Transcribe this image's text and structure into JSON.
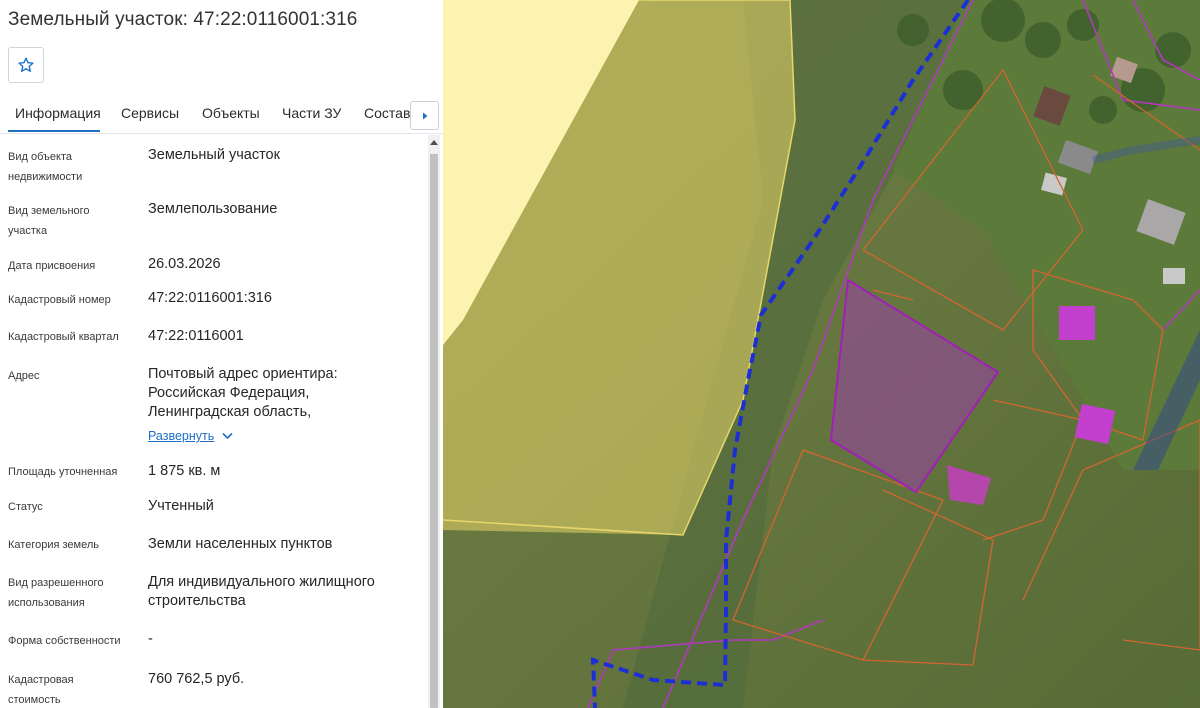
{
  "header": {
    "title": "Земельный участок: 47:22:0116001:316",
    "favorite_icon": "star-outline-icon"
  },
  "tabs": [
    {
      "label": "Информация",
      "active": true
    },
    {
      "label": "Сервисы"
    },
    {
      "label": "Объекты"
    },
    {
      "label": "Части ЗУ"
    },
    {
      "label": "Состав"
    }
  ],
  "tabs_next_icon": "caret-right-icon",
  "info": {
    "object_type": {
      "label_1": "Вид объекта",
      "label_2": "недвижимости",
      "value": "Земельный участок"
    },
    "parcel_type": {
      "label_1": "Вид земельного",
      "label_2": "участка",
      "value": "Землепользование"
    },
    "date": {
      "label": "Дата присвоения",
      "value": "26.03.2026"
    },
    "cad_number": {
      "label": "Кадастровый номер",
      "value": "47:22:0116001:316"
    },
    "cad_quarter": {
      "label": "Кадастровый квартал",
      "value": "47:22:0116001"
    },
    "address": {
      "label": "Адрес",
      "line_1": "Почтовый адрес ориентира:",
      "line_2": "Российская Федерация,",
      "line_3": "Ленинградская область,",
      "expand": "Развернуть"
    },
    "area": {
      "label": "Площадь уточненная",
      "value": "1 875 кв. м"
    },
    "status": {
      "label": "Статус",
      "value": "Учтенный"
    },
    "land_category": {
      "label": "Категория земель",
      "value": "Земли населенных пунктов"
    },
    "permitted_use": {
      "label_1": "Вид разрешенного",
      "label_2": "использования",
      "value_1": "Для индивидуального жилищного",
      "value_2": "строительства"
    },
    "ownership": {
      "label": "Форма собственности",
      "value": "-"
    },
    "cad_value": {
      "label_1": "Кадастровая",
      "label_2": "стоимость",
      "value": "760 762,5 руб."
    }
  },
  "colors": {
    "accent": "#1f6fc5",
    "selected_parcel": "#a11fb8",
    "quarter_boundary": "#1c2fd6",
    "parcel_boundary": "#d2662f",
    "zone_fill": "#fdf3b0"
  }
}
